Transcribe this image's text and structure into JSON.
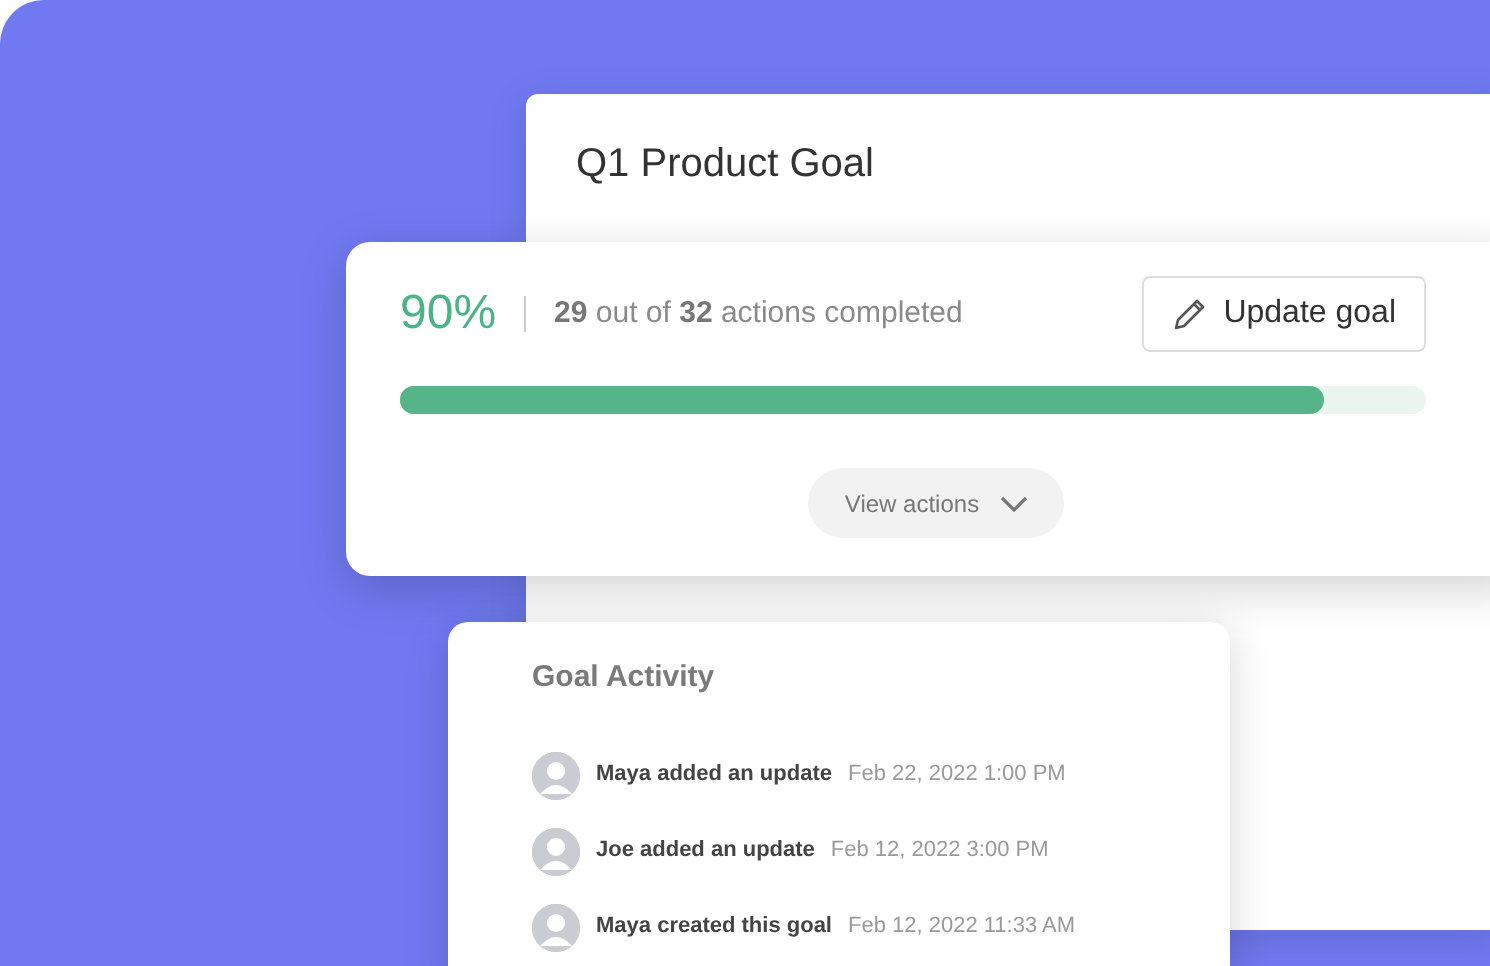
{
  "goal_card": {
    "title": "Q1 Product Goal"
  },
  "progress_card": {
    "percent": "90%",
    "summary": "**29** out of **32** actions completed",
    "update_button": "Update goal",
    "progress": {
      "level": 0.9
    },
    "view_button": "View actions"
  },
  "activity": {
    "title": "Goal Activity",
    "items": [
      {
        "text": "Maya added an update",
        "time": "Feb 22, 2022 1:00 PM"
      },
      {
        "text": "Joe added an update",
        "time": "Feb 12, 2022 3:00 PM"
      },
      {
        "text": "Maya created this goal",
        "time": "Feb 12, 2022 11:33 AM"
      }
    ]
  }
}
